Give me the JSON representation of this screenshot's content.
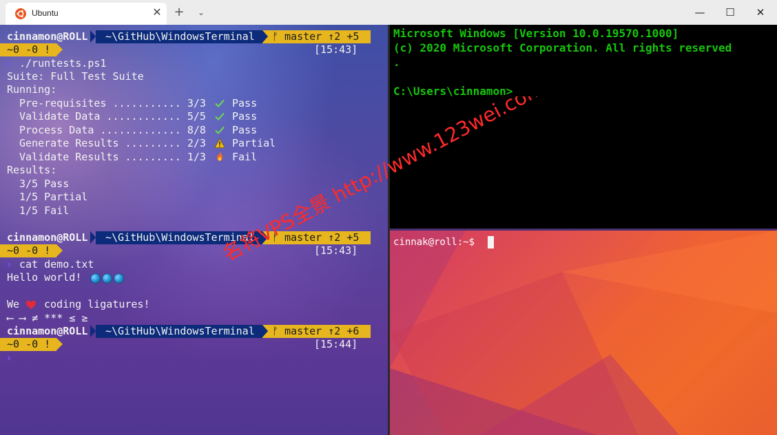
{
  "tab": {
    "title": "Ubuntu",
    "close": "✕",
    "new_tab": "+",
    "dropdown": "⌄"
  },
  "window": {
    "minimize": "—",
    "maximize": "☐",
    "close": "✕"
  },
  "left_pane": {
    "prompt_user": "cinnamon@ROLL",
    "prompt_path": "~\\GitHub\\WindowsTerminal",
    "prompt_status": "~0 -0 !",
    "block1": {
      "branch": "ᚠ master ↑2 +5",
      "time": "[15:43]",
      "command": "./runtests.ps1"
    },
    "suite": "Suite: Full Test Suite",
    "running": "Running:",
    "tests": [
      {
        "name": "Pre-requisites ........... 3/3",
        "status": "Pass",
        "icon": "check-icon"
      },
      {
        "name": "Validate Data ............ 5/5",
        "status": "Pass",
        "icon": "check-icon"
      },
      {
        "name": "Process Data ............. 8/8",
        "status": "Pass",
        "icon": "check-icon"
      },
      {
        "name": "Generate Results ......... 2/3",
        "status": "Partial",
        "icon": "warning-icon"
      },
      {
        "name": "Validate Results ......... 1/3",
        "status": "Fail",
        "icon": "fire-icon"
      }
    ],
    "results_label": "Results:",
    "results": [
      "3/5 Pass",
      "1/5 Partial",
      "1/5 Fail"
    ],
    "block2": {
      "branch": "ᚠ master ↑2 +5",
      "time": "[15:43]",
      "command": "cat demo.txt"
    },
    "hello": "Hello world!",
    "we": "We",
    "coding": "coding ligatures!",
    "ligatures": "⟵ ⟶ ≠ *** ≤ ≥",
    "block3": {
      "branch": "ᚠ master ↑2 +6",
      "time": "[15:44]"
    }
  },
  "cmd_pane": {
    "lines": [
      "Microsoft Windows [Version 10.0.19570.1000]",
      "(c) 2020 Microsoft Corporation. All rights reserved",
      ".",
      "",
      "C:\\Users\\cinnamon>"
    ]
  },
  "ubuntu_pane": {
    "prompt": "cinnak@roll:~$"
  },
  "watermark": "名将VPS全景 http://www.123wei.com",
  "colors": {
    "path_segment": "#0c2b7a",
    "branch_segment": "#e7b61e",
    "cmd_text": "#16c60c",
    "ubuntu_orange": "#e95420"
  }
}
